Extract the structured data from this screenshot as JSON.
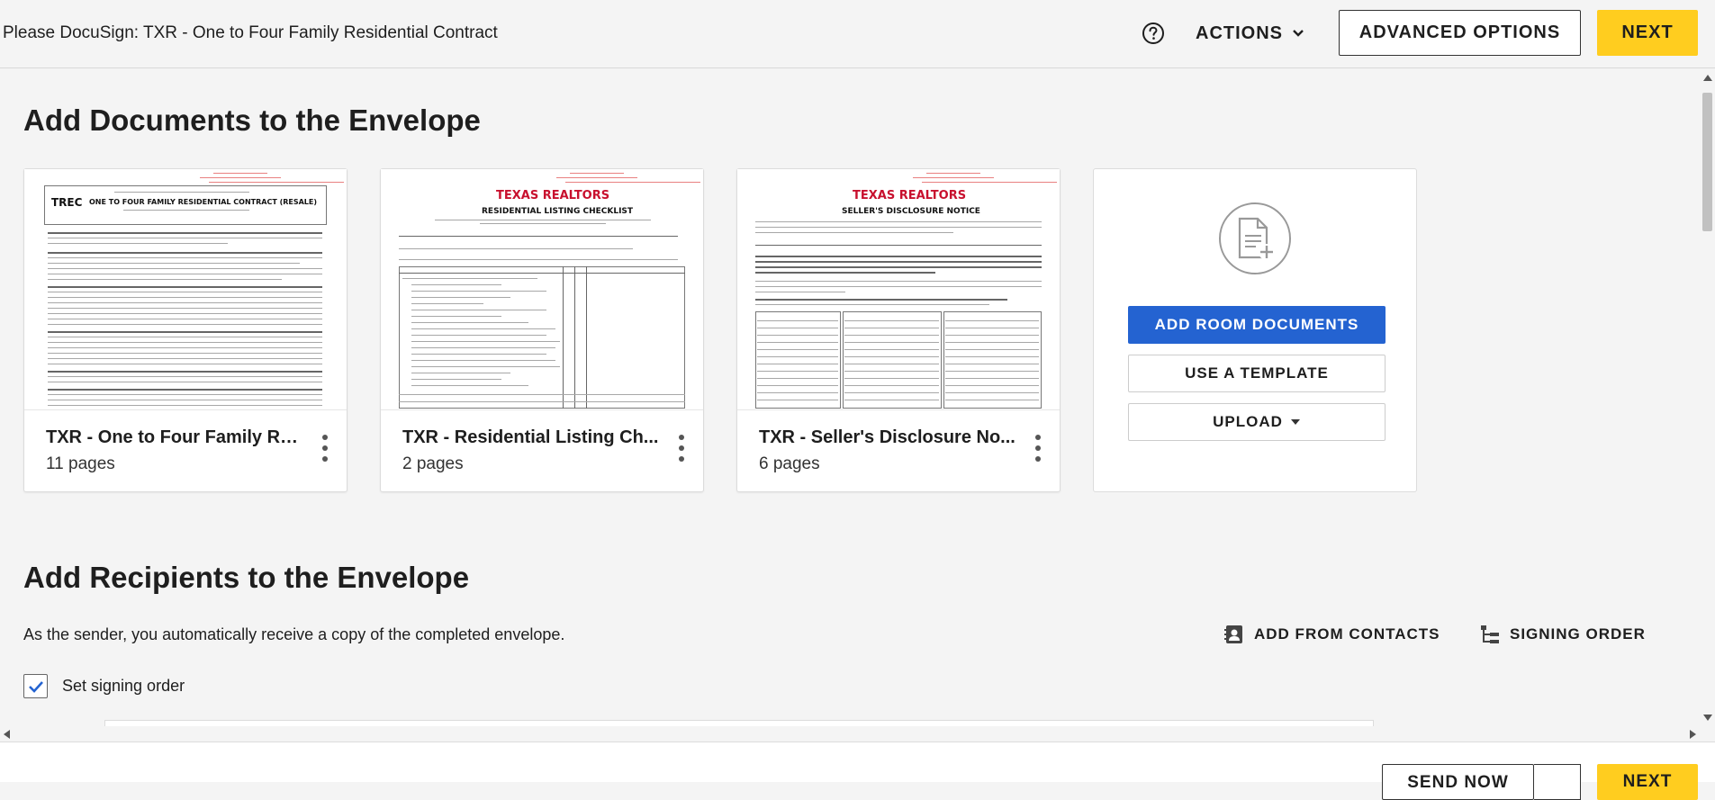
{
  "header": {
    "title": "Please DocuSign: TXR - One to Four Family Residential Contract",
    "help_icon": "question-circle-icon",
    "actions_label": "ACTIONS",
    "advanced_label": "ADVANCED OPTIONS",
    "next_label": "NEXT"
  },
  "documents_section": {
    "heading": "Add Documents to the Envelope",
    "documents": [
      {
        "name": "TXR - One to Four Family Re...",
        "pages": "11 pages",
        "thumb_title": "ONE TO FOUR FAMILY RESIDENTIAL CONTRACT (RESALE)",
        "thumb_logo": "TREC"
      },
      {
        "name": "TXR - Residential Listing Ch...",
        "pages": "2 pages",
        "thumb_title": "RESIDENTIAL LISTING CHECKLIST",
        "thumb_logo": "TEXAS REALTORS"
      },
      {
        "name": "TXR - Seller's Disclosure No...",
        "pages": "6 pages",
        "thumb_title": "SELLER'S DISCLOSURE NOTICE",
        "thumb_logo": "TEXAS REALTORS"
      }
    ],
    "add_card": {
      "icon": "add-document-icon",
      "add_room_label": "ADD ROOM DOCUMENTS",
      "template_label": "USE A TEMPLATE",
      "upload_label": "UPLOAD"
    }
  },
  "recipients_section": {
    "heading": "Add Recipients to the Envelope",
    "sender_note": "As the sender, you automatically receive a copy of the completed envelope.",
    "add_contacts_label": "ADD FROM CONTACTS",
    "signing_order_label": "SIGNING ORDER",
    "set_signing_order_label": "Set signing order",
    "set_signing_order_checked": true
  },
  "footer": {
    "send_label": "SEND NOW",
    "next_label": "NEXT"
  },
  "colors": {
    "accent_yellow": "#ffcd1f",
    "primary_blue": "#2463d1",
    "checkbox_check": "#2463d1",
    "realtors_red": "#c8102e"
  }
}
